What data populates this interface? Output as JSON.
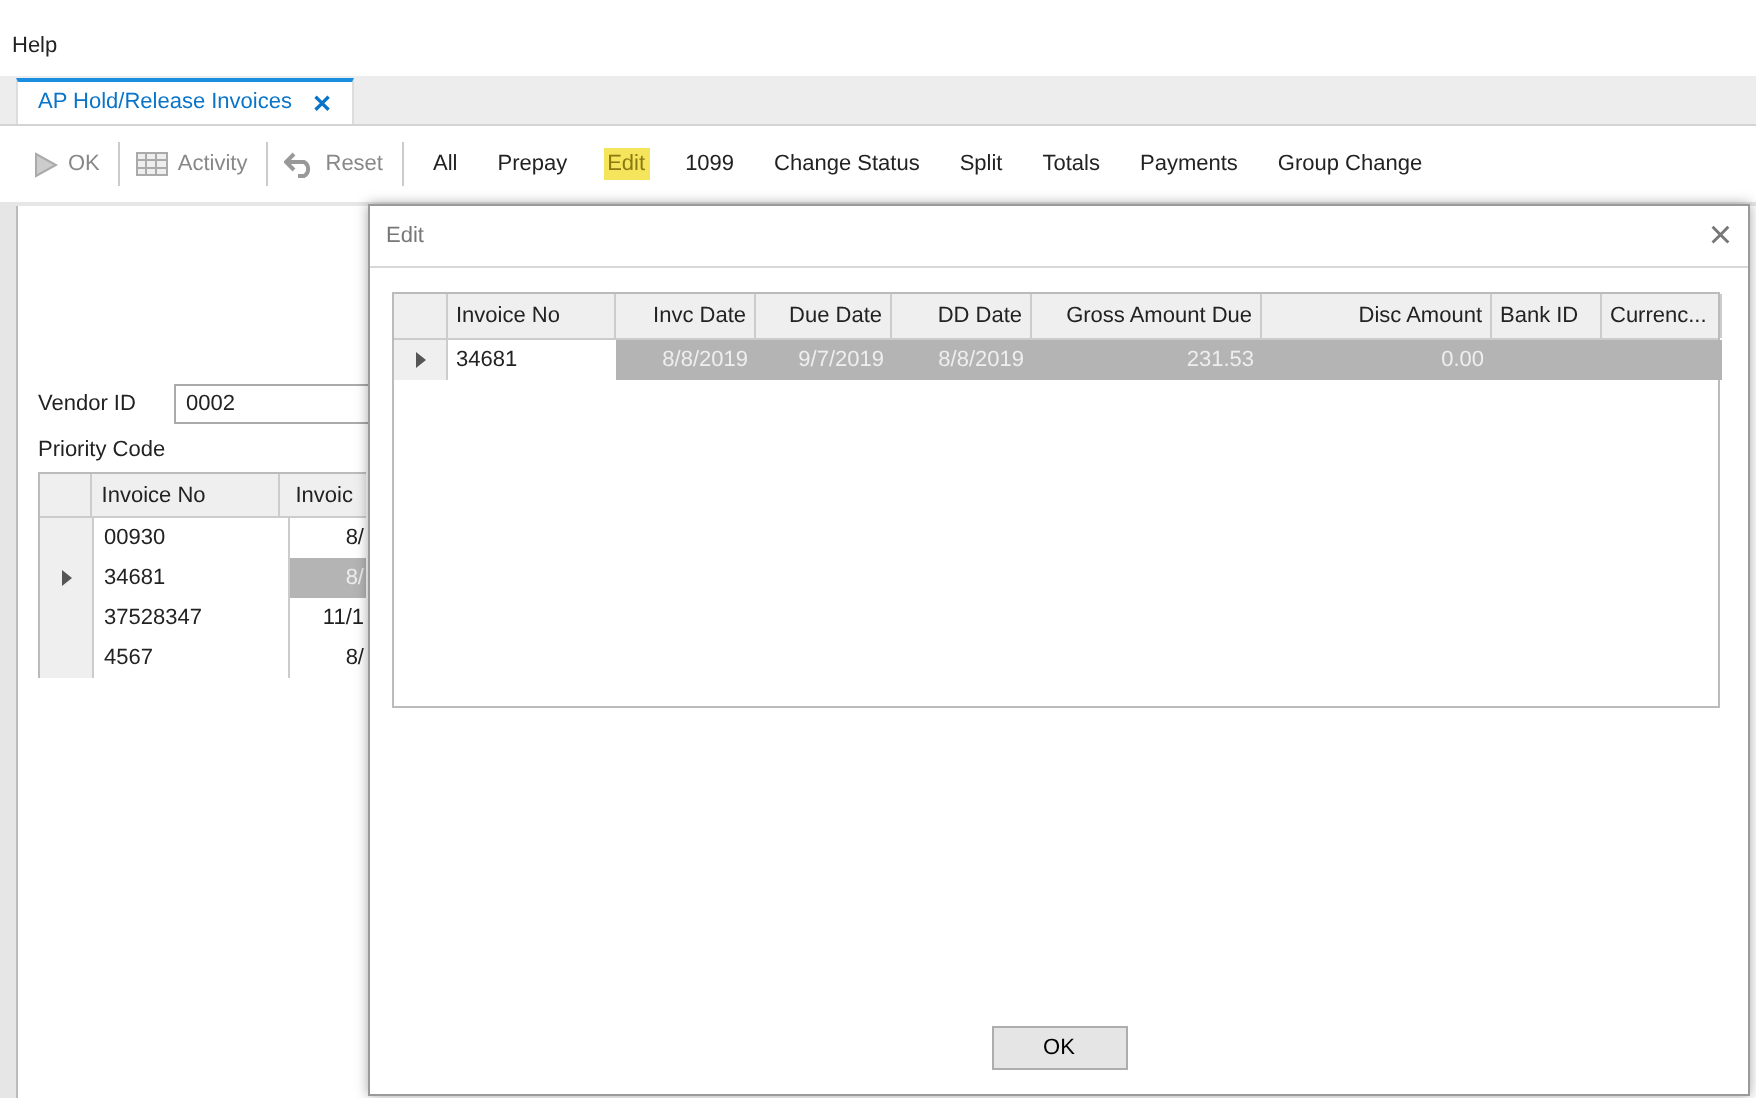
{
  "menu": [
    "Help"
  ],
  "tabs": [
    {
      "label": "AP Hold/Release Invoices",
      "selected": true,
      "close": "✕"
    }
  ],
  "toolbar": [
    {
      "kind": "play",
      "label": "OK",
      "disabled": true
    },
    {
      "kind": "grid",
      "label": "Activity",
      "disabled": true
    },
    {
      "kind": "undo",
      "label": "Reset",
      "disabled": true
    },
    {
      "kind": "text",
      "label": "All",
      "highlighted": false
    },
    {
      "kind": "text",
      "label": "Prepay",
      "highlighted": false
    },
    {
      "kind": "text",
      "label": "Edit",
      "highlighted": true
    },
    {
      "kind": "text",
      "label": "1099",
      "highlighted": false
    },
    {
      "kind": "text",
      "label": "Change Status",
      "highlighted": false
    },
    {
      "kind": "text",
      "label": "Split",
      "highlighted": false
    },
    {
      "kind": "text",
      "label": "Totals",
      "highlighted": false
    },
    {
      "kind": "text",
      "label": "Payments",
      "highlighted": false
    },
    {
      "kind": "text",
      "label": "Group Change",
      "highlighted": false
    }
  ],
  "form": {
    "vendor_id": {
      "label": "Vendor ID",
      "value": "0002"
    },
    "priority_code": {
      "label": "Priority Code"
    }
  },
  "invoice_grid": {
    "columns": [
      "Invoice No",
      "Invoic"
    ],
    "rows": [
      {
        "cells": [
          "00930",
          "8/"
        ],
        "selected": false
      },
      {
        "cells": [
          "34681",
          "8/"
        ],
        "selected": true
      },
      {
        "cells": [
          "37528347",
          "11/1"
        ],
        "selected": false
      },
      {
        "cells": [
          "4567",
          "8/"
        ],
        "selected": false
      }
    ]
  },
  "dialog": {
    "title": "Edit",
    "close": "×",
    "columns": [
      "Invoice No",
      "Invc Date",
      "Due Date",
      "DD Date",
      "Gross Amount Due",
      "Disc Amount",
      "Bank ID",
      "Currenc..."
    ],
    "rows": [
      {
        "cells": [
          "34681",
          "8/8/2019",
          "9/7/2019",
          "8/8/2019",
          "231.53",
          "0.00"
        ],
        "selected": true
      }
    ],
    "button": "OK"
  }
}
